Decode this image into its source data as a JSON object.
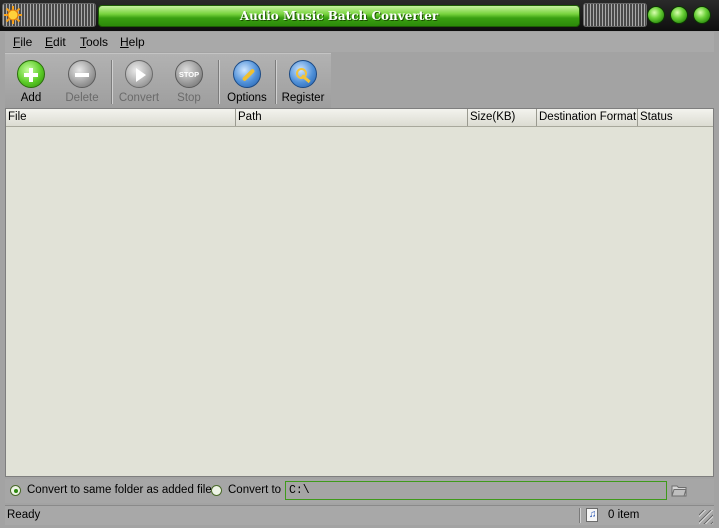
{
  "window": {
    "title": "Audio Music Batch Converter"
  },
  "menu": [
    {
      "label": "File",
      "accel": "F",
      "rest": "ile"
    },
    {
      "label": "Edit",
      "accel": "E",
      "rest": "dit"
    },
    {
      "label": "Tools",
      "accel": "T",
      "rest": "ools"
    },
    {
      "label": "Help",
      "accel": "H",
      "rest": "elp"
    }
  ],
  "toolbar": {
    "add": "Add",
    "delete": "Delete",
    "convert": "Convert",
    "stop": "Stop",
    "stop_icon_text": "STOP",
    "options": "Options",
    "register": "Register"
  },
  "columns": [
    "File",
    "Path",
    "Size(KB)",
    "Destination Format",
    "Status"
  ],
  "output": {
    "same_folder_label": "Convert to same folder as added file",
    "convert_to_label": "Convert to",
    "path": "C:\\",
    "selected": "same_folder"
  },
  "status": {
    "text": "Ready",
    "count": "0 item"
  },
  "colors": {
    "title_green": "#3aa012",
    "list_bg": "#e1e2d7",
    "chrome_gray": "#a3a3a3"
  },
  "icons": {
    "app": "sun-icon",
    "add": "plus-circle-icon",
    "delete": "minus-circle-icon",
    "convert": "play-circle-icon",
    "stop": "stop-sign-icon",
    "options": "wrench-icon",
    "register": "key-icon",
    "browse": "folder-icon",
    "status": "music-note-icon"
  }
}
